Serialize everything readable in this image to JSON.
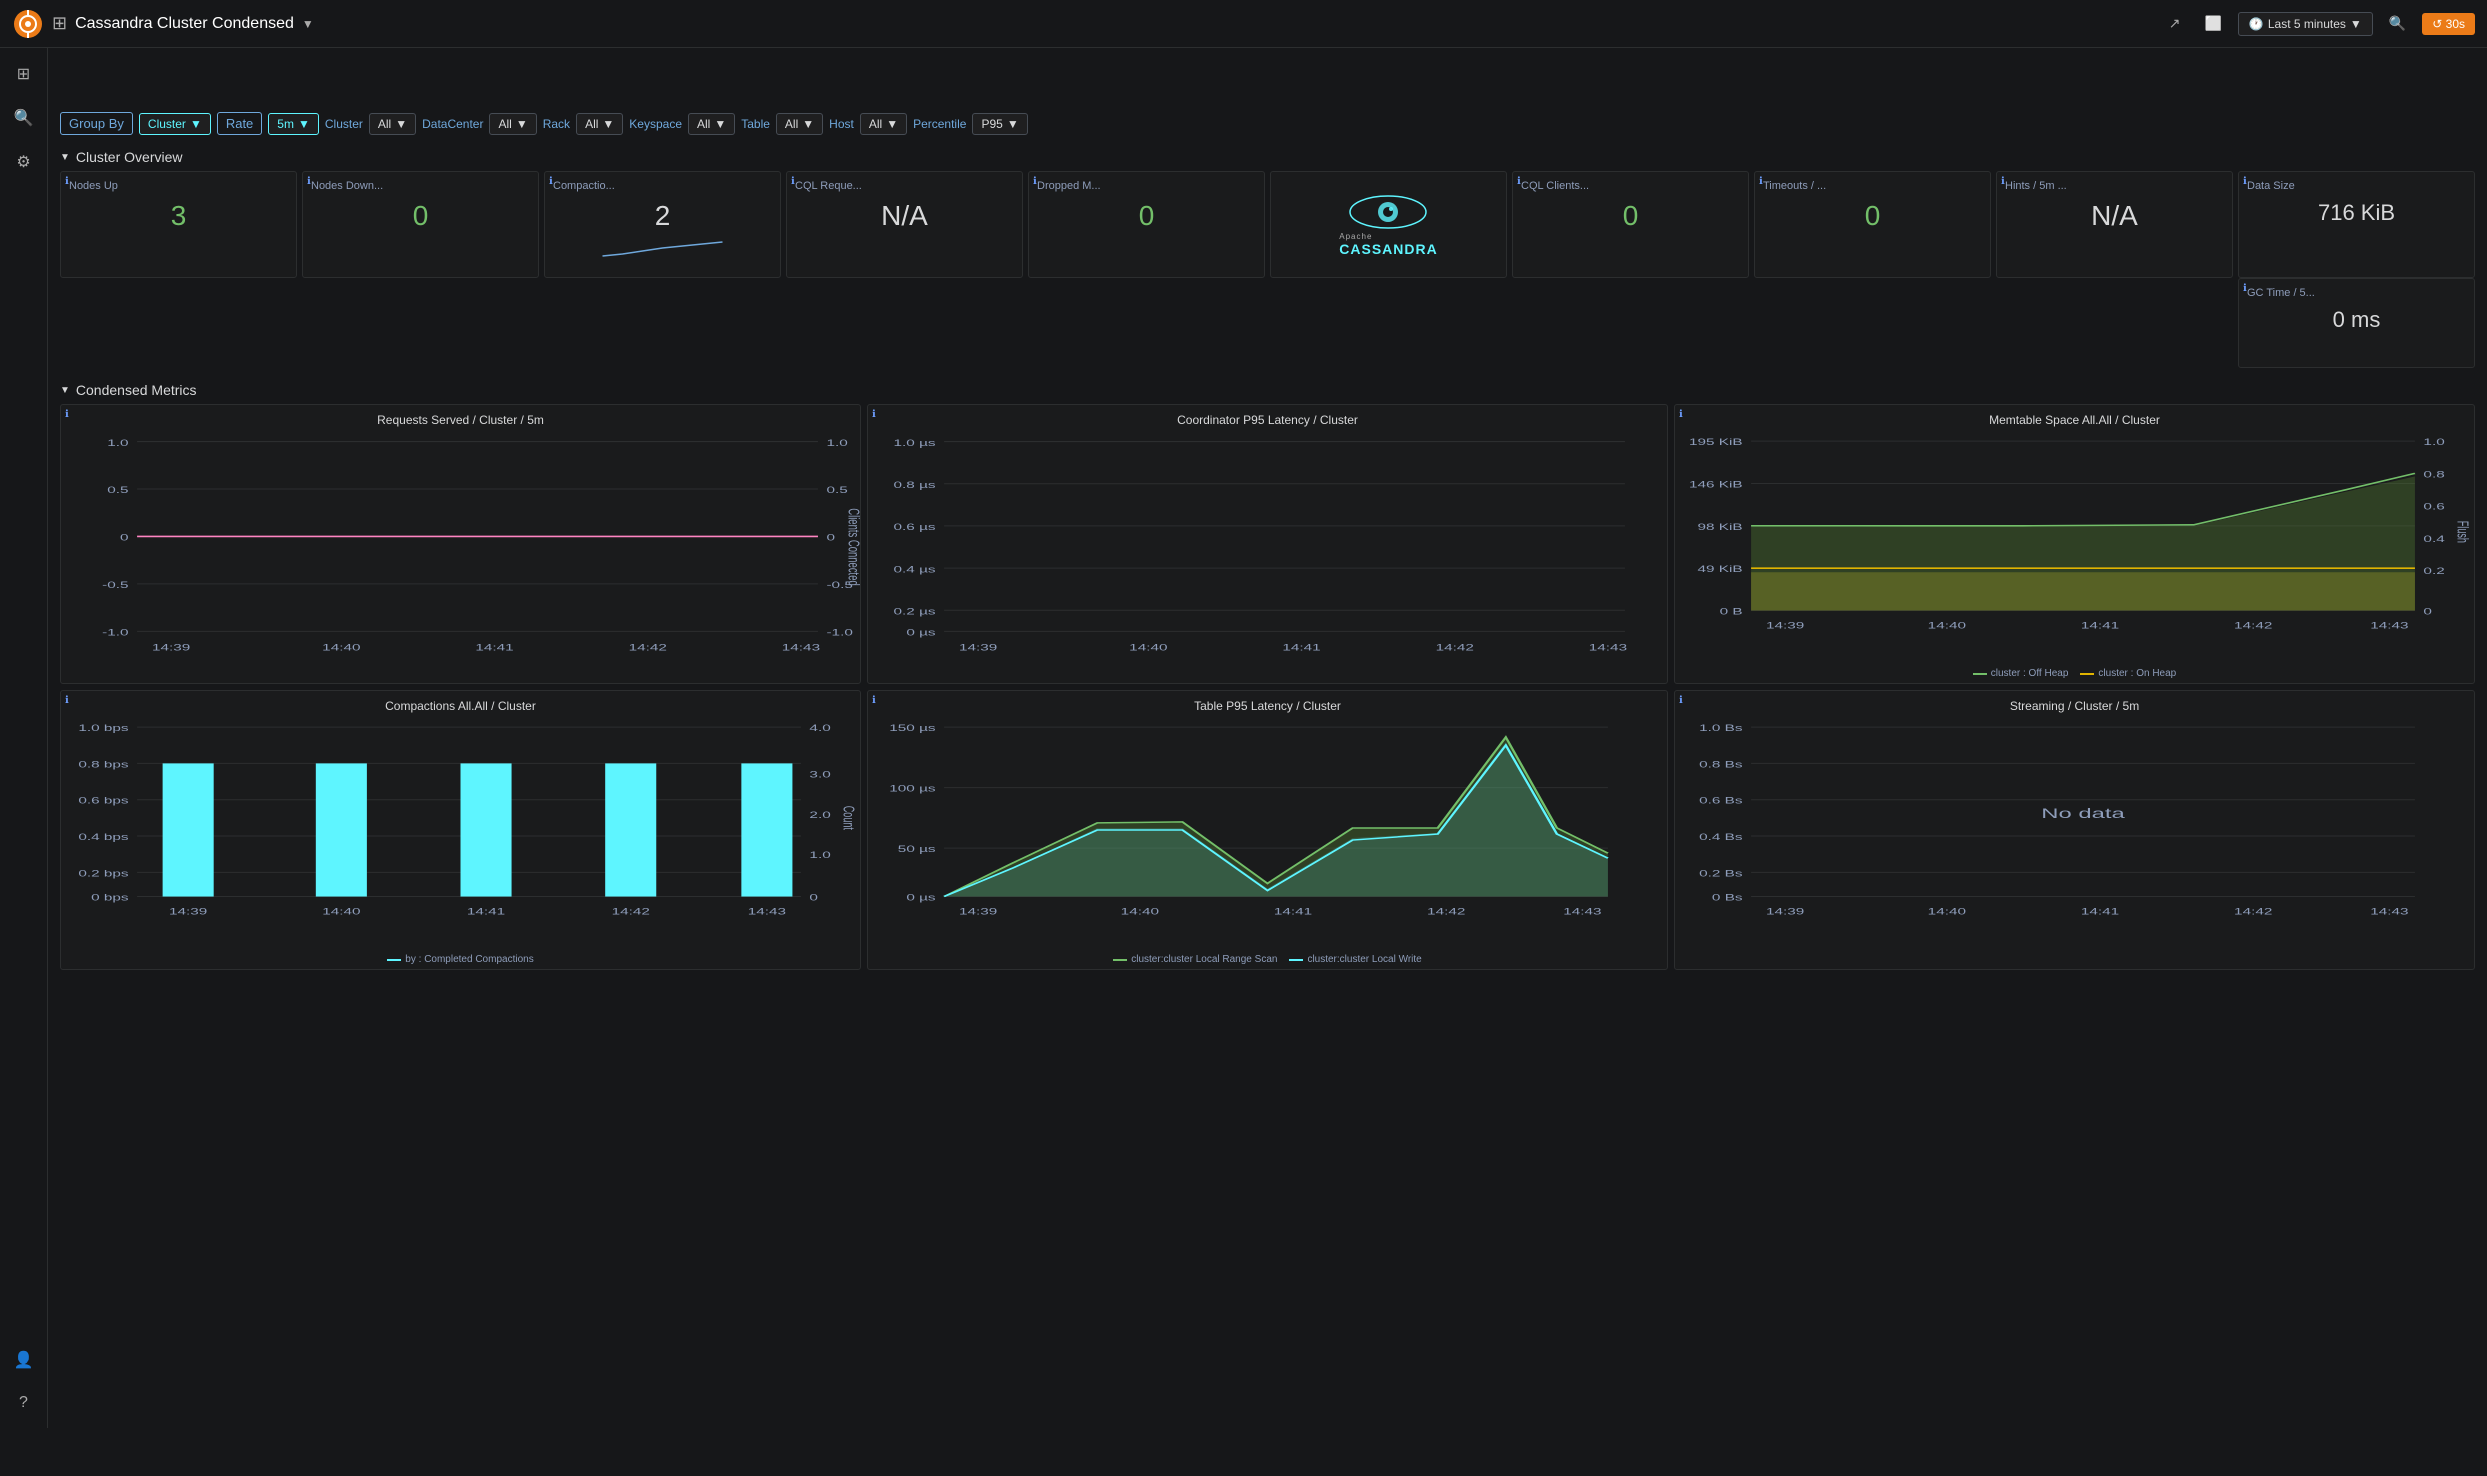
{
  "app": {
    "title": "Cassandra Cluster Condensed",
    "logo_icon": "🟠"
  },
  "topnav": {
    "share_icon": "↗",
    "tv_icon": "📺",
    "time_range": "Last 5 minutes",
    "search_icon": "🔍",
    "refresh_interval": "30s"
  },
  "filters": {
    "group_by_label": "Group By",
    "group_by_value": "Cluster",
    "rate_label": "Rate",
    "rate_value": "5m",
    "cluster_label": "Cluster",
    "cluster_value": "All",
    "datacenter_label": "DataCenter",
    "datacenter_value": "All",
    "rack_label": "Rack",
    "rack_value": "All",
    "keyspace_label": "Keyspace",
    "keyspace_value": "All",
    "table_label": "Table",
    "table_value": "All",
    "host_label": "Host",
    "host_value": "All",
    "percentile_label": "Percentile",
    "percentile_value": "P95"
  },
  "cluster_overview": {
    "section_title": "Cluster Overview",
    "stats": [
      {
        "id": "nodes-up",
        "title": "Nodes Up",
        "value": "3",
        "color": "green"
      },
      {
        "id": "nodes-down",
        "title": "Nodes Down...",
        "value": "0",
        "color": "green"
      },
      {
        "id": "compaction",
        "title": "Compactio...",
        "value": "2",
        "color": "white",
        "has_sparkline": true
      },
      {
        "id": "cql-requests",
        "title": "CQL Reque...",
        "value": "N/A",
        "color": "white"
      },
      {
        "id": "dropped-messages",
        "title": "Dropped M...",
        "value": "0",
        "color": "green"
      },
      {
        "id": "cql-clients",
        "title": "CQL Clients...",
        "value": "0",
        "color": "green"
      },
      {
        "id": "timeouts",
        "title": "Timeouts / ...",
        "value": "0",
        "color": "green"
      },
      {
        "id": "hints",
        "title": "Hints / 5m ...",
        "value": "N/A",
        "color": "white"
      },
      {
        "id": "data-size",
        "title": "Data Size",
        "value": "716 KiB",
        "color": "white"
      },
      {
        "id": "gc-time",
        "title": "GC Time / 5...",
        "value": "0 ms",
        "color": "white"
      }
    ]
  },
  "condensed_metrics": {
    "section_title": "Condensed Metrics",
    "charts": {
      "requests_served": {
        "title": "Requests Served / Cluster / 5m",
        "y_labels": [
          "1.0",
          "0.5",
          "0",
          "-0.5",
          "-1.0"
        ],
        "y_right_labels": [
          "1.0",
          "0.5",
          "0",
          "-0.5",
          "-1.0"
        ],
        "x_labels": [
          "14:39",
          "14:40",
          "14:41",
          "14:42",
          "14:43"
        ],
        "right_axis_label": "Clients Connected"
      },
      "coordinator_latency": {
        "title": "Coordinator P95 Latency / Cluster",
        "y_labels": [
          "1.0 µs",
          "0.8 µs",
          "0.6 µs",
          "0.4 µs",
          "0.2 µs",
          "0 µs"
        ],
        "x_labels": [
          "14:39",
          "14:40",
          "14:41",
          "14:42",
          "14:43"
        ]
      },
      "memtable_space": {
        "title": "Memtable Space All.All / Cluster",
        "y_labels": [
          "195 KiB",
          "146 KiB",
          "98 KiB",
          "49 KiB",
          "0 B"
        ],
        "y_right_labels": [
          "1.0",
          "0.8",
          "0.6",
          "0.4",
          "0.2",
          "0"
        ],
        "x_labels": [
          "14:39",
          "14:40",
          "14:41",
          "14:42",
          "14:43"
        ],
        "right_axis_label": "Flush",
        "legend": [
          {
            "label": "cluster : Off Heap",
            "color": "#73bf69"
          },
          {
            "label": "cluster : On Heap",
            "color": "#e0b400"
          }
        ]
      },
      "compactions": {
        "title": "Compactions All.All / Cluster",
        "y_labels": [
          "1.0 bps",
          "0.8 bps",
          "0.6 bps",
          "0.4 bps",
          "0.2 bps",
          "0 bps"
        ],
        "y_right_labels": [
          "4.0",
          "3.0",
          "2.0",
          "1.0",
          "0"
        ],
        "x_labels": [
          "14:39",
          "14:40",
          "14:41",
          "14:42",
          "14:43"
        ],
        "right_axis_label": "Count",
        "legend": [
          {
            "label": "by : Completed Compactions",
            "color": "#5ef5ff"
          }
        ]
      },
      "table_latency": {
        "title": "Table P95 Latency / Cluster",
        "y_labels": [
          "150 µs",
          "100 µs",
          "50 µs",
          "0 µs"
        ],
        "x_labels": [
          "14:39",
          "14:40",
          "14:41",
          "14:42",
          "14:43"
        ],
        "legend": [
          {
            "label": "cluster:cluster Local Range Scan",
            "color": "#73bf69"
          },
          {
            "label": "cluster:cluster Local Write",
            "color": "#5ef5ff"
          }
        ]
      },
      "streaming": {
        "title": "Streaming / Cluster / 5m",
        "y_labels": [
          "1.0 Bs",
          "0.8 Bs",
          "0.6 Bs",
          "0.4 Bs",
          "0.2 Bs",
          "0 Bs"
        ],
        "x_labels": [
          "14:39",
          "14:40",
          "14:41",
          "14:42",
          "14:43"
        ],
        "no_data": "No data"
      }
    }
  }
}
